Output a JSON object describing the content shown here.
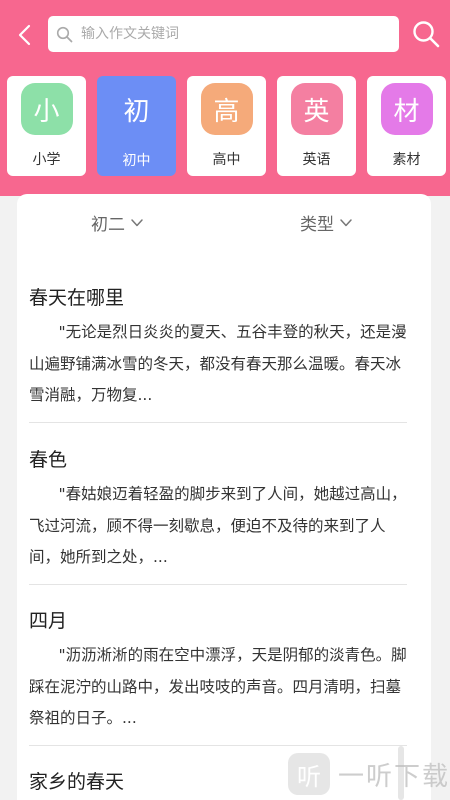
{
  "header": {
    "search_placeholder": "输入作文关键词"
  },
  "categories": [
    {
      "char": "小",
      "label": "小学",
      "color": "#8de0a8",
      "active": false
    },
    {
      "char": "初",
      "label": "初中",
      "color": "#6c8ef5",
      "active": true
    },
    {
      "char": "高",
      "label": "高中",
      "color": "#f5aa7a",
      "active": false
    },
    {
      "char": "英",
      "label": "英语",
      "color": "#f47fa1",
      "active": false
    },
    {
      "char": "材",
      "label": "素材",
      "color": "#e47ae8",
      "active": false
    }
  ],
  "filters": {
    "grade": "初二",
    "type": "类型"
  },
  "articles": [
    {
      "title": "春天在哪里",
      "excerpt": "\"无论是烈日炎炎的夏天、五谷丰登的秋天，还是漫山遍野铺满冰雪的冬天，都没有春天那么温暖。春天冰雪消融，万物复..."
    },
    {
      "title": "春色",
      "excerpt": "\"春姑娘迈着轻盈的脚步来到了人间，她越过高山，飞过河流，顾不得一刻歇息，便迫不及待的来到了人间，她所到之处，..."
    },
    {
      "title": "四月",
      "excerpt": "\"沥沥淅淅的雨在空中漂浮，天是阴郁的淡青色。脚踩在泥泞的山路中，发出吱吱的声音。四月清明，扫墓祭祖的日子。..."
    },
    {
      "title": "家乡的春天",
      "excerpt": ""
    }
  ],
  "watermark": {
    "logo_char": "听",
    "text": "一听下载"
  },
  "colors": {
    "header_pink": "#f7678f",
    "background_gray": "#f2f2f2",
    "active_blue": "#6c8ef5"
  }
}
